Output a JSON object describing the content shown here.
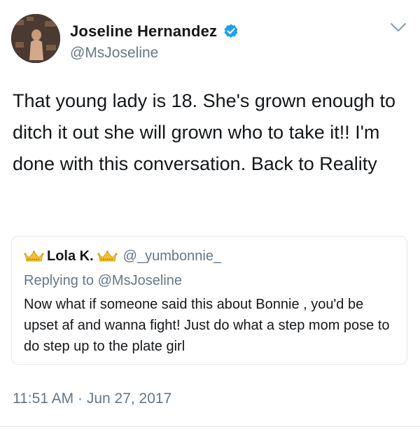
{
  "author": {
    "name": "Joseline Hernandez",
    "handle": "@MsJoseline",
    "verified": true
  },
  "tweet": {
    "text": "That young lady is 18. She's grown enough to ditch it out she will grown who to take it!! I'm done with this conversation. Back to Reality",
    "timestamp": "11:51 AM · Jun 27, 2017"
  },
  "quoted_tweet": {
    "name": "Lola K.",
    "handle": "@_yumbonnie_",
    "replying_to": "Replying to @MsJoseline",
    "text": "Now what if someone said this about Bonnie , you'd be upset af and wanna fight! Just do what a step mom pose to do step up to the plate girl"
  },
  "colors": {
    "verified_badge": "#1da1f2",
    "crown": "#f2c12e",
    "secondary_text": "#657786",
    "border": "#e1e8ed"
  },
  "icons": [
    "verified-badge-icon",
    "chevron-down-icon",
    "crown-emoji-icon"
  ]
}
